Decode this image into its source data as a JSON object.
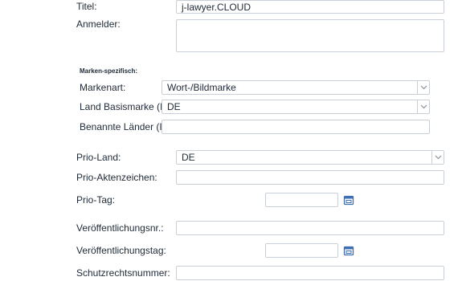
{
  "form": {
    "titel": {
      "label": "Titel:",
      "value": "j-lawyer.CLOUD"
    },
    "anmelder": {
      "label": "Anmelder:",
      "value": ""
    },
    "section_title": "Marken-spezifisch:",
    "markenart": {
      "label": "Markenart:",
      "value": "Wort-/Bildmarke"
    },
    "land_basismarke": {
      "label": "Land Basismarke (IR):",
      "value": "DE"
    },
    "benannte_laender": {
      "label": "Benannte Länder (IR):",
      "value": ""
    },
    "prio_land": {
      "label": "Prio-Land:",
      "value": "DE"
    },
    "prio_aktenzeichen": {
      "label": "Prio-Aktenzeichen:",
      "value": ""
    },
    "prio_tag": {
      "label": "Prio-Tag:",
      "value": ""
    },
    "veroeffentlichungsnr": {
      "label": "Veröffentlichungsnr.:",
      "value": ""
    },
    "veroeffentlichungstag": {
      "label": "Veröffentlichungstag:",
      "value": ""
    },
    "schutzrechtsnummer": {
      "label": "Schutzrechtsnummer:",
      "value": ""
    }
  },
  "icons": {
    "dropdown": "chevron-down-icon",
    "calendar": "calendar-icon"
  },
  "colors": {
    "text": "#1f2a36",
    "border": "#c9cfd6",
    "calendar_blue": "#3f6fb3"
  }
}
